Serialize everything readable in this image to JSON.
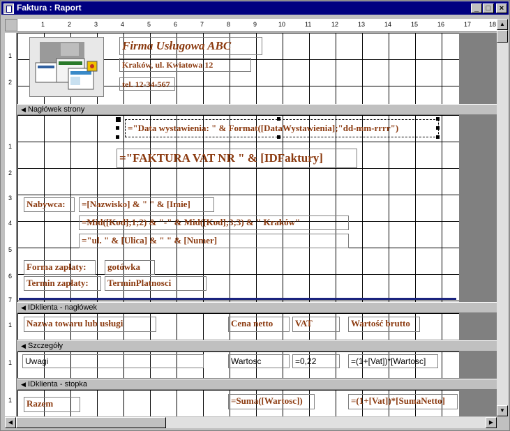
{
  "window": {
    "title": "Faktura : Raport"
  },
  "ruler": {
    "horizontal_ticks": [
      "1",
      "2",
      "3",
      "4",
      "5",
      "6",
      "7",
      "8",
      "9",
      "10",
      "11",
      "12",
      "13",
      "14",
      "15",
      "16",
      "17",
      "18"
    ],
    "vertical_ticks": [
      "1",
      "2",
      "1",
      "2",
      "3",
      "4",
      "5",
      "6",
      "7",
      "1",
      "1",
      "1"
    ]
  },
  "sections": {
    "page_header": "Nagłówek strony",
    "group_header": "IDklienta - nagłówek",
    "detail": "Szczegóły",
    "group_footer": "IDklienta - stopka"
  },
  "report_header": {
    "company_name": "Firma Usługowa ABC",
    "address": "Kraków, ul. Kwiatowa 12",
    "phone": "tel. 12-34-567"
  },
  "page_header": {
    "issue_date_expr": "=\"Data wystawienia: \" & Format([DataWystawienia];\"dd-mm-rrrr\")",
    "invoice_title_expr": "=\"FAKTURA VAT NR \" & [IDFaktury]",
    "buyer_label": "Nabywca:",
    "buyer_name_expr": "=[Nazwisko] & \" \" & [Imie]",
    "buyer_code_expr": "=Mid([Kod];1;2) & \"-\" & Mid([Kod];3;3) & \" Kraków\"",
    "buyer_street_expr": "=\"ul. \" & [Ulica] & \" \" & [Numer]",
    "payment_form_label": "Forma zapłaty:",
    "payment_form_value": "gotówka",
    "payment_term_label": "Termin zapłaty:",
    "payment_term_value": "TerminPlatnosci"
  },
  "group_header": {
    "col_item": "Nazwa towaru lub usługi",
    "col_net": "Cena netto",
    "col_vat": "VAT",
    "col_gross": "Wartość brutto"
  },
  "detail": {
    "notes": "Uwagi",
    "value": "Wartosc",
    "vat_value": "=0,22",
    "gross_expr": "=(1+[Vat])*[Wartosc]"
  },
  "group_footer": {
    "total_label": "Razem",
    "sum_expr": "=Suma([Wartosc])",
    "gross_sum_expr": "=(1+[Vat])*[SumaNetto]"
  },
  "colors": {
    "title_bar": "#000080",
    "control_text": "#8b3a0f",
    "divider_line": "#1a237e"
  }
}
